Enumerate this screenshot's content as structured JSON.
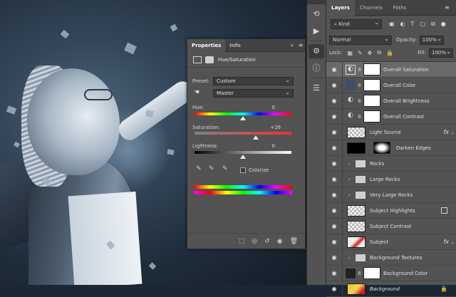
{
  "properties_panel": {
    "tabs": [
      "Properties",
      "Info"
    ],
    "header_title": "Hue/Saturation",
    "preset_label": "Preset:",
    "preset_value": "Custom",
    "channel_value": "Master",
    "hue_label": "Hue:",
    "hue_value": "0",
    "hue_level": 0.5,
    "saturation_label": "Saturation:",
    "saturation_value": "+26",
    "saturation_level": 0.63,
    "lightness_label": "Lightness:",
    "lightness_value": "0",
    "lightness_level": 0.5,
    "colorize_label": "Colorize",
    "colorize_checked": false
  },
  "layers_panel": {
    "tabs": [
      "Layers",
      "Channels",
      "Paths"
    ],
    "filter_kind": "Kind",
    "blend_mode": "Normal",
    "opacity_label": "Opacity:",
    "opacity_value": "100%",
    "lock_label": "Lock:",
    "fill_label": "Fill:",
    "fill_value": "100%",
    "layers": [
      {
        "name": "Overall Saturation",
        "selected": true
      },
      {
        "name": "Overall Color"
      },
      {
        "name": "Overall Brightness"
      },
      {
        "name": "Overall Contrast"
      },
      {
        "name": "Light Source"
      },
      {
        "name": "Darken Edges"
      },
      {
        "name": "Rocks"
      },
      {
        "name": "Large Rocks"
      },
      {
        "name": "Very Large Rocks"
      },
      {
        "name": "Subject Highlights"
      },
      {
        "name": "Subject Contrast"
      },
      {
        "name": "Subject"
      },
      {
        "name": "Background Textures"
      },
      {
        "name": "Background Color"
      },
      {
        "name": "Background"
      }
    ]
  },
  "icons": {
    "visibility": "eye-icon",
    "fx": "fx",
    "colors": {
      "panel": "#535353",
      "panel_dark": "#424242",
      "selected_row": "#6a6a6a"
    }
  }
}
